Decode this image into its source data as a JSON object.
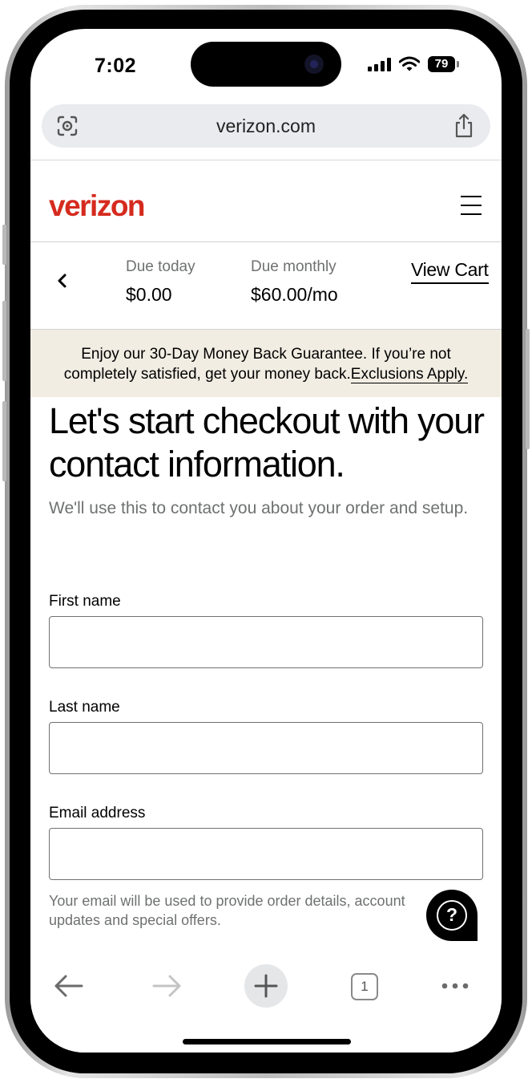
{
  "status_bar": {
    "time": "7:02",
    "battery": "79"
  },
  "browser": {
    "url": "verizon.com",
    "tab_count": "1"
  },
  "header": {
    "logo": "verizon"
  },
  "cart_strip": {
    "due_today_label": "Due today",
    "due_today_value": "$0.00",
    "due_monthly_label": "Due monthly",
    "due_monthly_value": "$60.00/mo",
    "view_cart": "View Cart"
  },
  "banner": {
    "line1": "Enjoy our 30-Day Money Back Guarantee. If you’re not",
    "line2": "completely satisfied, get your money back.",
    "link": "Exclusions Apply."
  },
  "form": {
    "title": "Let's start checkout with your contact information.",
    "subtitle": "We'll use this to contact you about your order and setup.",
    "first_name": {
      "label": "First name",
      "value": ""
    },
    "last_name": {
      "label": "Last name",
      "value": ""
    },
    "email": {
      "label": "Email address",
      "value": ""
    },
    "email_note": "Your email will be used to provide order details, account updates and special offers."
  },
  "help_button": {
    "glyph": "?"
  },
  "icons": {
    "lens": "visual-search-icon",
    "share": "share-icon",
    "menu": "hamburger-menu-icon",
    "back": "chevron-left-icon",
    "help": "chat-help-icon"
  },
  "colors": {
    "brand_red": "#d52b1e",
    "banner_bg": "#f2ede3",
    "muted_text": "#6f7171"
  }
}
